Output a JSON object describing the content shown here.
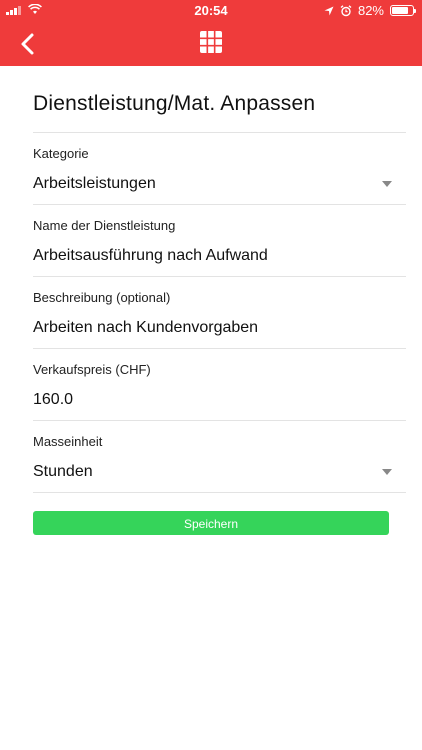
{
  "status_bar": {
    "time": "20:54",
    "battery": "82%",
    "battery_level": 0.82
  },
  "nav": {
    "back_icon": "chevron-left-icon",
    "center_icon": "grid-icon",
    "color": "#ef3b3b"
  },
  "page": {
    "title": "Dienstleistung/Mat. Anpassen"
  },
  "fields": [
    {
      "label": "Kategorie",
      "value": "Arbeitsleistungen",
      "type": "select"
    },
    {
      "label": "Name der Dienstleistung",
      "value": "Arbeitsausführung nach Aufwand",
      "type": "text"
    },
    {
      "label": "Beschreibung (optional)",
      "value": "Arbeiten nach Kundenvorgaben",
      "type": "text"
    },
    {
      "label": "Verkaufspreis (CHF)",
      "value": "160.0",
      "type": "text"
    },
    {
      "label": "Masseinheit",
      "value": "Stunden",
      "type": "select"
    }
  ],
  "save_button": {
    "label": "Speichern",
    "color": "#35d45a"
  }
}
